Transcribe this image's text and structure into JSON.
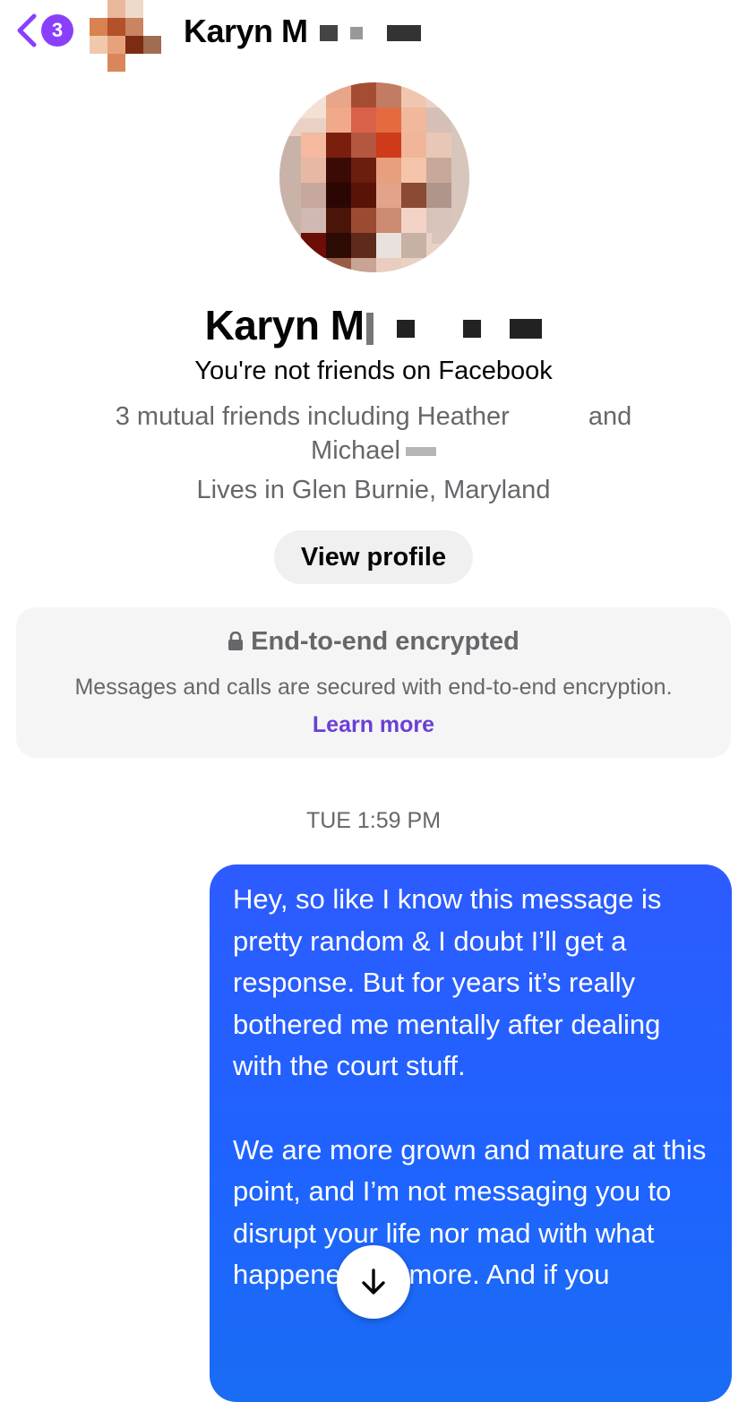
{
  "header": {
    "back_badge_count": "3",
    "contact_name_visible": "Karyn M",
    "icons": {
      "back": "chevron-left-icon"
    }
  },
  "profile": {
    "name_visible": "Karyn M",
    "friend_status": "You're not friends on Facebook",
    "mutual_friends_prefix": "3 mutual friends including Heather",
    "mutual_friends_and": "and",
    "mutual_friends_second": "Michael",
    "lives_in": "Lives in Glen Burnie, Maryland",
    "view_profile_label": "View profile"
  },
  "encryption": {
    "title": "End-to-end encrypted",
    "body": "Messages and calls are secured with end-to-end encryption.",
    "link": "Learn more",
    "icon": "lock-icon"
  },
  "conversation": {
    "timestamp": "TUE 1:59 PM",
    "messages": [
      {
        "direction": "outgoing",
        "paragraphs": [
          "Hey, so like I know this message is pretty random & I doubt I’ll get a response. But for years it’s really bothered me mentally after dealing with the court stuff.",
          "We are more grown and mature at this point, and I’m not messaging you to disrupt your life nor mad with what happened anymore. And if you"
        ]
      }
    ],
    "scroll_icon": "arrow-down-icon"
  },
  "colors": {
    "accent": "#8a3ffc",
    "link": "#6b3fd6",
    "bubble": "#1f63ff",
    "secondary_text": "#65676b",
    "card_bg": "#f5f5f5"
  }
}
